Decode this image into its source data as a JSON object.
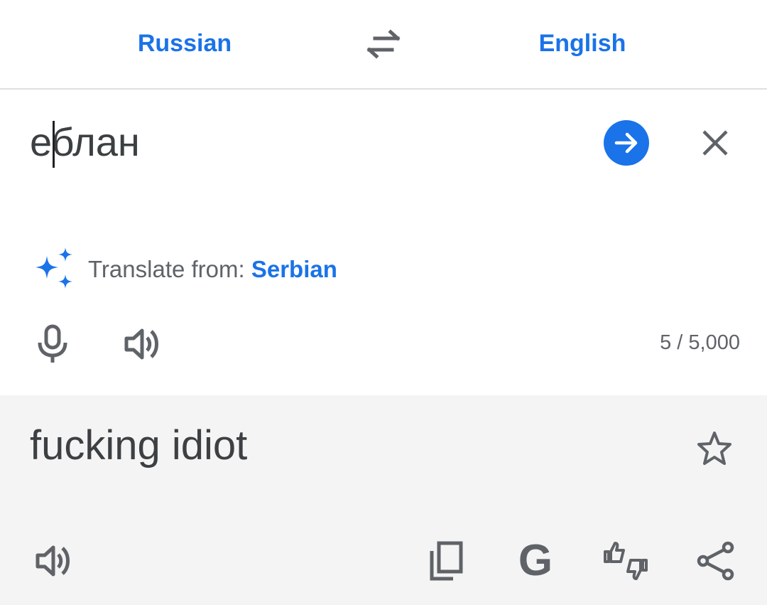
{
  "language_bar": {
    "source_language": "Russian",
    "target_language": "English",
    "swap_icon": "swap-arrows-icon"
  },
  "input": {
    "source_text": "еблан",
    "submit_icon": "arrow-forward-icon",
    "clear_icon": "close-icon",
    "suggestion_prefix": "Translate from: ",
    "suggestion_language": "Serbian",
    "suggestion_icon": "sparkle-icon",
    "mic_icon": "microphone-icon",
    "speaker_icon": "speaker-icon",
    "char_count": "5 / 5,000"
  },
  "result": {
    "translated_text": "fucking idiot",
    "star_icon": "star-outline-icon",
    "actions": [
      {
        "name": "listen",
        "icon": "speaker-icon"
      },
      {
        "name": "copy",
        "icon": "copy-icon"
      },
      {
        "name": "google-search",
        "icon": "google-g-icon",
        "glyph": "G"
      },
      {
        "name": "feedback",
        "icon": "thumbs-up-down-icon"
      },
      {
        "name": "share",
        "icon": "share-icon"
      }
    ]
  },
  "colors": {
    "accent": "#1a73e8",
    "icon_gray": "#5f6368",
    "text": "#3c4043",
    "result_bg": "#f4f4f4",
    "divider": "#e0e0e0"
  }
}
